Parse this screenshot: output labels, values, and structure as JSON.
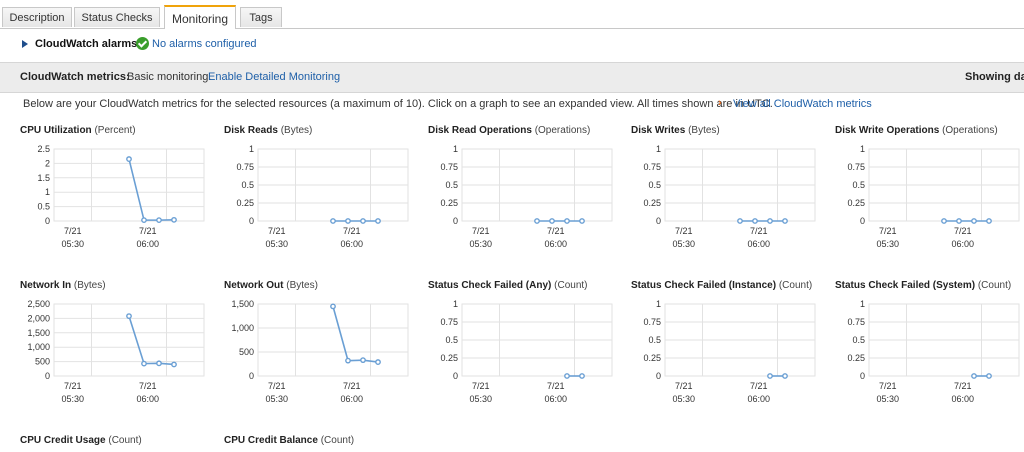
{
  "tabs": [
    {
      "label": "Description",
      "active": false
    },
    {
      "label": "Status Checks",
      "active": false
    },
    {
      "label": "Monitoring",
      "active": true
    },
    {
      "label": "Tags",
      "active": false
    }
  ],
  "alarms": {
    "label": "CloudWatch alarms:",
    "status_icon": "green-check-icon",
    "value": "No alarms configured"
  },
  "metrics_bar": {
    "label": "CloudWatch metrics:",
    "value": "Basic monitoring.",
    "link": "Enable Detailed Monitoring",
    "right_text": "Showing dat"
  },
  "intro": {
    "text": "Below are your CloudWatch metrics for the selected resources (a maximum of 10). Click on a graph to see an expanded view. All times shown are in UTC.",
    "arrow": "›",
    "link": "View all CloudWatch metrics"
  },
  "colors": {
    "accent": "#f0a30a",
    "link": "#1e5fa8",
    "line": "#6a9fd4",
    "grid": "#e2e2e2",
    "ok": "#3a9e2b"
  },
  "chart_data": [
    {
      "type": "line",
      "name": "CPU Utilization",
      "unit": "(Percent)",
      "yticks": [
        "2.5",
        "2",
        "1.5",
        "1",
        "0.5",
        "0"
      ],
      "ylim": [
        0,
        2.5
      ],
      "xticks": [
        [
          "7/21",
          "05:30"
        ],
        [
          "7/21",
          "06:00"
        ]
      ],
      "x_range": [
        0,
        2
      ],
      "x": [
        1.0,
        1.2,
        1.4,
        1.6
      ],
      "y": [
        2.15,
        0.03,
        0.03,
        0.04
      ]
    },
    {
      "type": "line",
      "name": "Disk Reads",
      "unit": "(Bytes)",
      "yticks": [
        "1",
        "0.75",
        "0.5",
        "0.25",
        "0"
      ],
      "ylim": [
        0,
        1
      ],
      "xticks": [
        [
          "7/21",
          "05:30"
        ],
        [
          "7/21",
          "06:00"
        ]
      ],
      "x_range": [
        0,
        2
      ],
      "x": [
        1.0,
        1.2,
        1.4,
        1.6
      ],
      "y": [
        0,
        0,
        0,
        0
      ]
    },
    {
      "type": "line",
      "name": "Disk Read Operations",
      "unit": "(Operations)",
      "yticks": [
        "1",
        "0.75",
        "0.5",
        "0.25",
        "0"
      ],
      "ylim": [
        0,
        1
      ],
      "xticks": [
        [
          "7/21",
          "05:30"
        ],
        [
          "7/21",
          "06:00"
        ]
      ],
      "x_range": [
        0,
        2
      ],
      "x": [
        1.0,
        1.2,
        1.4,
        1.6
      ],
      "y": [
        0,
        0,
        0,
        0
      ]
    },
    {
      "type": "line",
      "name": "Disk Writes",
      "unit": "(Bytes)",
      "yticks": [
        "1",
        "0.75",
        "0.5",
        "0.25",
        "0"
      ],
      "ylim": [
        0,
        1
      ],
      "xticks": [
        [
          "7/21",
          "05:30"
        ],
        [
          "7/21",
          "06:00"
        ]
      ],
      "x_range": [
        0,
        2
      ],
      "x": [
        1.0,
        1.2,
        1.4,
        1.6
      ],
      "y": [
        0,
        0,
        0,
        0
      ]
    },
    {
      "type": "line",
      "name": "Disk Write Operations",
      "unit": "(Operations)",
      "yticks": [
        "1",
        "0.75",
        "0.5",
        "0.25",
        "0"
      ],
      "ylim": [
        0,
        1
      ],
      "xticks": [
        [
          "7/21",
          "05:30"
        ],
        [
          "7/21",
          "06:00"
        ]
      ],
      "x_range": [
        0,
        2
      ],
      "x": [
        1.0,
        1.2,
        1.4,
        1.6
      ],
      "y": [
        0,
        0,
        0,
        0
      ]
    },
    {
      "type": "line",
      "name": "Network In",
      "unit": "(Bytes)",
      "yticks": [
        "2,500",
        "2,000",
        "1,500",
        "1,000",
        "500",
        "0"
      ],
      "ylim": [
        0,
        2500
      ],
      "xticks": [
        [
          "7/21",
          "05:30"
        ],
        [
          "7/21",
          "06:00"
        ]
      ],
      "x_range": [
        0,
        2
      ],
      "x": [
        1.0,
        1.2,
        1.4,
        1.6
      ],
      "y": [
        2080,
        430,
        440,
        400
      ]
    },
    {
      "type": "line",
      "name": "Network Out",
      "unit": "(Bytes)",
      "yticks": [
        "1,500",
        "1,000",
        "500",
        "0"
      ],
      "ylim": [
        0,
        1500
      ],
      "xticks": [
        [
          "7/21",
          "05:30"
        ],
        [
          "7/21",
          "06:00"
        ]
      ],
      "x_range": [
        0,
        2
      ],
      "x": [
        1.0,
        1.2,
        1.4,
        1.6
      ],
      "y": [
        1450,
        320,
        330,
        290
      ]
    },
    {
      "type": "line",
      "name": "Status Check Failed (Any)",
      "unit": "(Count)",
      "yticks": [
        "1",
        "0.75",
        "0.5",
        "0.25",
        "0"
      ],
      "ylim": [
        0,
        1
      ],
      "xticks": [
        [
          "7/21",
          "05:30"
        ],
        [
          "7/21",
          "06:00"
        ]
      ],
      "x_range": [
        0,
        2
      ],
      "x": [
        1.4,
        1.6
      ],
      "y": [
        0,
        0
      ]
    },
    {
      "type": "line",
      "name": "Status Check Failed (Instance)",
      "unit": "(Count)",
      "yticks": [
        "1",
        "0.75",
        "0.5",
        "0.25",
        "0"
      ],
      "ylim": [
        0,
        1
      ],
      "xticks": [
        [
          "7/21",
          "05:30"
        ],
        [
          "7/21",
          "06:00"
        ]
      ],
      "x_range": [
        0,
        2
      ],
      "x": [
        1.4,
        1.6
      ],
      "y": [
        0,
        0
      ]
    },
    {
      "type": "line",
      "name": "Status Check Failed (System)",
      "unit": "(Count)",
      "yticks": [
        "1",
        "0.75",
        "0.5",
        "0.25",
        "0"
      ],
      "ylim": [
        0,
        1
      ],
      "xticks": [
        [
          "7/21",
          "05:30"
        ],
        [
          "7/21",
          "06:00"
        ]
      ],
      "x_range": [
        0,
        2
      ],
      "x": [
        1.4,
        1.6
      ],
      "y": [
        0,
        0
      ]
    },
    {
      "type": "line",
      "name": "CPU Credit Usage",
      "unit": "(Count)",
      "yticks": [],
      "ylim": [
        0,
        1
      ],
      "xticks": [],
      "x_range": [
        0,
        2
      ],
      "x": [],
      "y": []
    },
    {
      "type": "line",
      "name": "CPU Credit Balance",
      "unit": "(Count)",
      "yticks": [],
      "ylim": [
        0,
        1
      ],
      "xticks": [],
      "x_range": [
        0,
        2
      ],
      "x": [],
      "y": []
    }
  ]
}
